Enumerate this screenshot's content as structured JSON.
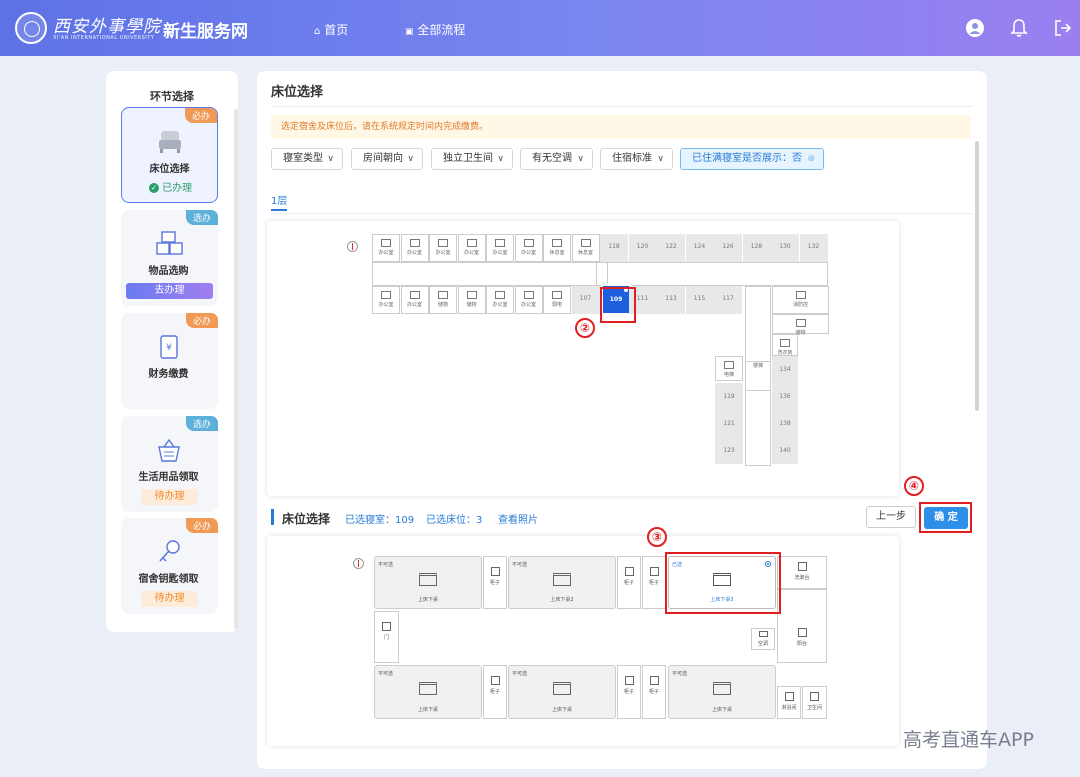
{
  "header": {
    "logo_text": "西安外事學院",
    "logo_en": "XI'AN INTERNATIONAL UNIVERSITY",
    "app_title": "新生服务网",
    "nav": [
      {
        "label": "首页",
        "icon": "home-icon"
      },
      {
        "label": "全部流程",
        "icon": "flow-icon"
      }
    ],
    "icons": [
      "user-icon",
      "bell-icon",
      "logout-icon"
    ]
  },
  "sidebar": {
    "title": "环节选择",
    "steps": [
      {
        "label": "床位选择",
        "tag": "必办",
        "status": "已办理",
        "icon": "bed-icon"
      },
      {
        "label": "物品选购",
        "tag": "选办",
        "status": "去办理",
        "icon": "boxes-icon"
      },
      {
        "label": "财务缴费",
        "tag": "必办",
        "status": "",
        "icon": "payment-icon"
      },
      {
        "label": "生活用品领取",
        "tag": "选办",
        "status": "待办理",
        "icon": "basket-icon"
      },
      {
        "label": "宿舍钥匙领取",
        "tag": "必办",
        "status": "待办理",
        "icon": "key-icon"
      }
    ]
  },
  "main": {
    "title": "床位选择",
    "notice": "选定宿舍及床位后，请在系统规定时间内完成缴费。",
    "filters": [
      {
        "label": "寝室类型"
      },
      {
        "label": "房间朝向"
      },
      {
        "label": "独立卫生间"
      },
      {
        "label": "有无空调"
      },
      {
        "label": "住宿标准"
      },
      {
        "label": "已住满寝室是否展示：否"
      }
    ],
    "floor_tab": "1层",
    "floorplan": {
      "top_rooms": [
        "办公室",
        "办公室",
        "办公室",
        "办公室",
        "办公室",
        "办公室",
        "休息室",
        "休息室"
      ],
      "top_numbers": [
        "118",
        "120",
        "122",
        "124",
        "126",
        "128",
        "130",
        "132"
      ],
      "bottom_rooms": [
        "办公室",
        "办公室",
        "储物",
        "储物",
        "办公室",
        "办公室",
        "弱电"
      ],
      "bottom_numbers": [
        "107",
        "109",
        "111",
        "113",
        "115",
        "117"
      ],
      "selected_room": "109",
      "right_labels": [
        "消防控",
        "储物",
        "洗衣房"
      ],
      "right_numbers": [
        "134",
        "136",
        "138",
        "140"
      ],
      "left_numbers": [
        "119",
        "121",
        "123"
      ],
      "left_label": "电梯",
      "stair_label": "楼梯"
    },
    "bed_section": {
      "title": "床位选择",
      "selected_room_text": "已选寝室：109",
      "selected_bed_text": "已选床位：3",
      "photo_link": "查看照片",
      "prev_label": "上一步",
      "confirm_label": "确 定",
      "beds": [
        {
          "state": "不可选",
          "label": "上床下桌"
        },
        {
          "state": "不可选",
          "label": "上床下桌2"
        },
        {
          "state": "已选",
          "label": "上床下桌3"
        },
        {
          "state": "不可选",
          "label": "上床下桌"
        },
        {
          "state": "不可选",
          "label": "上床下桌"
        },
        {
          "state": "不可选",
          "label": "上床下桌"
        }
      ],
      "items": {
        "cabinet": "柜子",
        "wash": "洗漱台",
        "door": "门",
        "aircon": "空调",
        "balcony": "阳台",
        "shower": "淋浴间",
        "toilet": "卫生间"
      }
    }
  },
  "annotations": [
    "②",
    "③",
    "④"
  ],
  "watermark": "高考直通车APP",
  "colors": {
    "accent": "#2a7bd6",
    "selected": "#1e5fe0",
    "highlight": "#e02020"
  }
}
